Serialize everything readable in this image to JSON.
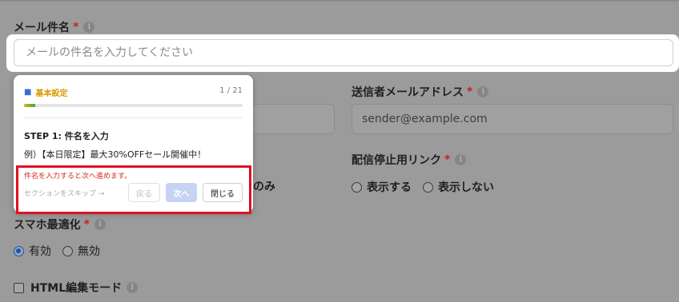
{
  "form": {
    "subject": {
      "label": "メール件名",
      "required_mark": "*",
      "info": "i",
      "placeholder": "メールの件名を入力してください"
    },
    "sender_email": {
      "label": "送信者メールアドレス",
      "required_mark": "*",
      "info": "i",
      "value": "sender@example.com"
    },
    "unsubscribe": {
      "label": "配信停止用リンク",
      "required_mark": "*",
      "info": "i",
      "options": [
        "表示する",
        "表示しない"
      ]
    },
    "partial_option_text": "のみ",
    "mobile": {
      "label": "スマホ最適化",
      "required_mark": "*",
      "info": "i",
      "options": [
        "有効",
        "無効"
      ],
      "selected": "有効"
    },
    "html_mode": {
      "label": "HTML編集モード",
      "info": "i",
      "checked": false
    }
  },
  "tour": {
    "section_icon": "flag-icon",
    "section_label": "基本設定",
    "counter": "1 / 21",
    "progress": 0.05,
    "step_title": "STEP 1: 件名を入力",
    "example": "例）【本日限定】最大30%OFFセール開催中！",
    "error": "件名を入力すると次へ進めます。",
    "skip_label": "セクションをスキップ →",
    "back_label": "戻る",
    "next_label": "次へ",
    "close_label": "閉じる"
  },
  "colors": {
    "required": "#c8202a",
    "highlight_border": "#e01020",
    "progress_start": "#e0b400",
    "progress_end": "#3fa84a",
    "radio_selected": "#0d57c4"
  }
}
